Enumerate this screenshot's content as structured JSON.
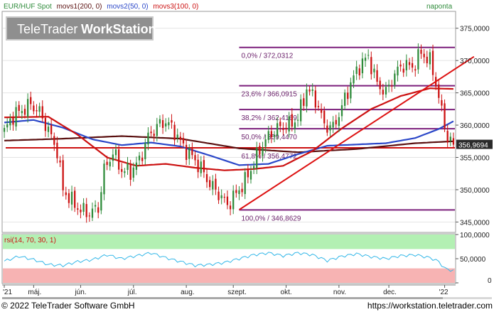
{
  "chart_data": {
    "type": "candlestick",
    "title": "EUR/HUF Spot",
    "legend": [
      {
        "text": "EUR/HUF Spot",
        "color": "#2e8b3a"
      },
      {
        "text": "movs1(200, 0)",
        "color": "#5a1010"
      },
      {
        "text": "movs2(50, 0)",
        "color": "#2b47c8"
      },
      {
        "text": "movs3(100, 0)",
        "color": "#cc1111"
      }
    ],
    "period": "naponta",
    "watermark": {
      "part1": "TeleTrader",
      "part2": "WorkStation"
    },
    "y_ticks": [
      "375,0000",
      "370,0000",
      "365,0000",
      "360,0000",
      "355,0000",
      "350,0000",
      "345,0000"
    ],
    "y_tick_values": [
      375,
      370,
      365,
      360,
      355,
      350,
      345
    ],
    "ylim": [
      343.5,
      377.5
    ],
    "last_price": {
      "label": "356,9694",
      "value": 356.9694
    },
    "fib_levels": [
      {
        "label": "0,0% / 372,0312",
        "value": 372.0312
      },
      {
        "label": "23,6% / 366,0915",
        "value": 366.0915
      },
      {
        "label": "38,2% / 362,4169",
        "value": 362.4169
      },
      {
        "label": "50,0% / 359,4470",
        "value": 359.447
      },
      {
        "label": "61,8% / 356,4772",
        "value": 356.4772
      },
      {
        "label": "100,0% / 346,8629",
        "value": 346.8629
      }
    ],
    "x_labels": [
      "'21",
      "máj.",
      "jún.",
      "júl.",
      "aug.",
      "szept.",
      "okt.",
      "nov.",
      "dec.",
      "'22"
    ],
    "close_anchors": [
      [
        0,
        359.0
      ],
      [
        3,
        361.5
      ],
      [
        6,
        362.3
      ],
      [
        9,
        363.2
      ],
      [
        12,
        362.0
      ],
      [
        15,
        359.2
      ],
      [
        18,
        356.0
      ],
      [
        20,
        350.0
      ],
      [
        23,
        348.2
      ],
      [
        26,
        346.8
      ],
      [
        29,
        346.4
      ],
      [
        32,
        347.2
      ],
      [
        34,
        353.0
      ],
      [
        37,
        355.8
      ],
      [
        40,
        353.0
      ],
      [
        43,
        352.8
      ],
      [
        46,
        354.5
      ],
      [
        49,
        358.2
      ],
      [
        52,
        359.8
      ],
      [
        55,
        360.6
      ],
      [
        58,
        359.0
      ],
      [
        61,
        356.6
      ],
      [
        64,
        355.1
      ],
      [
        67,
        353.3
      ],
      [
        70,
        350.9
      ],
      [
        73,
        349.4
      ],
      [
        76,
        347.6
      ],
      [
        79,
        349.4
      ],
      [
        82,
        351.3
      ],
      [
        85,
        354.2
      ],
      [
        88,
        357.0
      ],
      [
        91,
        358.8
      ],
      [
        94,
        359.7
      ],
      [
        97,
        360.0
      ],
      [
        100,
        361.1
      ],
      [
        103,
        365.6
      ],
      [
        106,
        364.0
      ],
      [
        109,
        360.0
      ],
      [
        112,
        359.6
      ],
      [
        115,
        362.8
      ],
      [
        118,
        366.5
      ],
      [
        121,
        369.2
      ],
      [
        124,
        370.6
      ],
      [
        127,
        366.4
      ],
      [
        130,
        365.0
      ],
      [
        133,
        367.9
      ],
      [
        136,
        369.4
      ],
      [
        139,
        368.9
      ],
      [
        142,
        371.2
      ],
      [
        145,
        369.9
      ],
      [
        147,
        366.5
      ],
      [
        149,
        362.0
      ],
      [
        151,
        358.0
      ],
      [
        153,
        356.9694
      ]
    ],
    "ma_series": [
      {
        "name": "movs1(200, 0)",
        "color": "#5a1010",
        "x": [
          0,
          20,
          40,
          60,
          80,
          100,
          120,
          140,
          153
        ],
        "y": [
          357.6,
          357.9,
          358.3,
          357.9,
          356.4,
          355.8,
          356.3,
          357.2,
          357.5
        ]
      },
      {
        "name": "movs2(50, 0)",
        "color": "#2b47c8",
        "x": [
          0,
          10,
          20,
          30,
          40,
          50,
          60,
          70,
          80,
          90,
          100,
          110,
          120,
          130,
          140,
          148,
          153
        ],
        "y": [
          360.4,
          360.8,
          359.6,
          357.8,
          356.9,
          357.3,
          356.7,
          355.3,
          353.8,
          354.0,
          355.5,
          356.8,
          357.0,
          357.2,
          358.0,
          359.4,
          360.6
        ]
      },
      {
        "name": "movs3(100, 0)",
        "color": "#cc1111",
        "x": [
          0,
          15,
          25,
          35,
          45,
          55,
          65,
          75,
          85,
          95,
          105,
          115,
          125,
          135,
          145,
          153
        ],
        "y": [
          361.2,
          361.3,
          358.5,
          355.0,
          353.7,
          354.0,
          353.4,
          353.0,
          353.2,
          353.7,
          356.0,
          359.5,
          362.5,
          364.5,
          365.7,
          365.6
        ]
      }
    ],
    "trendline": {
      "x": [
        80,
        160
      ],
      "y": [
        346.9,
        370.6
      ],
      "color": "#dd1111"
    },
    "rsi": {
      "label": "rsi(14, 70, 30, 1)",
      "y_ticks": [
        "100,0000",
        "50,0000",
        "0"
      ],
      "y_tick_values": [
        100,
        50,
        0
      ],
      "overbought": 70,
      "oversold": 30,
      "anchors": [
        [
          0,
          45
        ],
        [
          5,
          55
        ],
        [
          10,
          48
        ],
        [
          15,
          38
        ],
        [
          20,
          36
        ],
        [
          25,
          44
        ],
        [
          30,
          48
        ],
        [
          35,
          58
        ],
        [
          40,
          50
        ],
        [
          45,
          56
        ],
        [
          50,
          62
        ],
        [
          55,
          52
        ],
        [
          60,
          44
        ],
        [
          65,
          36
        ],
        [
          70,
          38
        ],
        [
          75,
          42
        ],
        [
          80,
          50
        ],
        [
          85,
          58
        ],
        [
          90,
          62
        ],
        [
          95,
          56
        ],
        [
          100,
          62
        ],
        [
          105,
          58
        ],
        [
          110,
          46
        ],
        [
          115,
          55
        ],
        [
          120,
          60
        ],
        [
          125,
          54
        ],
        [
          130,
          50
        ],
        [
          135,
          56
        ],
        [
          140,
          58
        ],
        [
          145,
          52
        ],
        [
          148,
          44
        ],
        [
          150,
          30
        ],
        [
          153,
          25
        ]
      ]
    }
  },
  "footer": {
    "copyright": "© 2022 TeleTrader Software GmbH",
    "url": "https://workstation.teletrader.com"
  }
}
